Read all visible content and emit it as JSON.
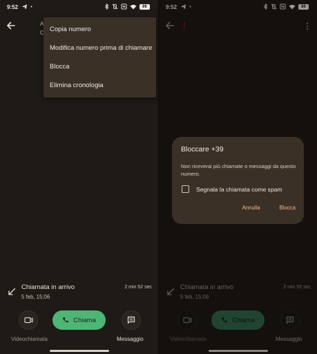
{
  "status_bar": {
    "time": "9:52",
    "battery": "86",
    "icons": [
      "telegram-icon",
      "dot-icon",
      "bluetooth-icon",
      "vibrate-off-icon",
      "nfc-icon",
      "wifi-icon",
      "battery-icon"
    ]
  },
  "left_screen": {
    "contact_fragment": [
      "A",
      "C"
    ],
    "overflow_menu": {
      "items": [
        "Copia numero",
        "Modifica numero prima di chiamare",
        "Blocca",
        "Elimina cronologia"
      ]
    }
  },
  "right_screen": {
    "dialog": {
      "title": "Bloccare +39",
      "body": "Non riceverai più chiamate o messaggi da questo numero.",
      "checkbox_label": "Segnala la chiamata come spam",
      "checkbox_checked": false,
      "cancel_label": "Annulla",
      "confirm_label": "Blocca",
      "accent_color": "#f0b98a"
    }
  },
  "call_log": {
    "title": "Chiamata in arrivo",
    "date": "5 feb, 15:06",
    "duration": "2 min 52 sec"
  },
  "actions": {
    "video_label": "Videochiamata",
    "call_label": "Chiama",
    "message_label": "Messaggio",
    "call_color": "#4fb576"
  }
}
